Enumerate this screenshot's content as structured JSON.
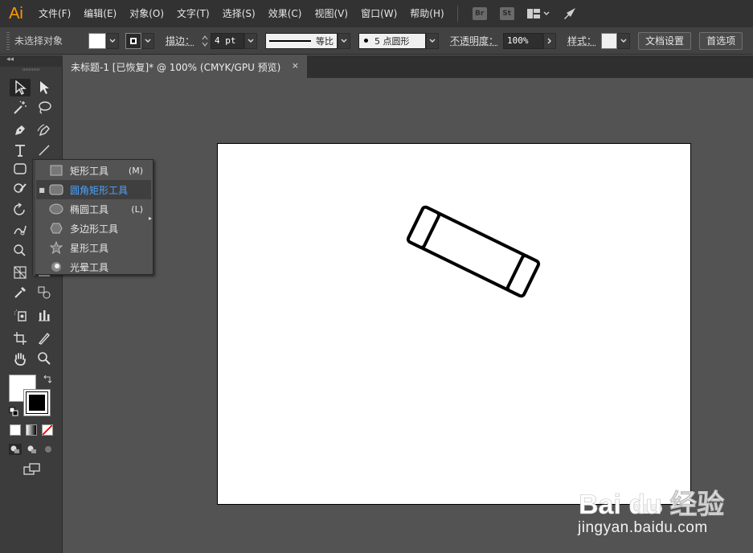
{
  "app": {
    "logo_text": "Ai"
  },
  "menu": {
    "items": [
      "文件(F)",
      "编辑(E)",
      "对象(O)",
      "文字(T)",
      "选择(S)",
      "效果(C)",
      "视图(V)",
      "窗口(W)",
      "帮助(H)"
    ],
    "bridge_label": "Br",
    "stock_label": "St"
  },
  "control": {
    "selection_text": "未选择对象",
    "stroke_label": "描边：",
    "stroke_weight": "4 pt",
    "profile_label": "等比",
    "brush_label": "5 点圆形",
    "opacity_label": "不透明度：",
    "opacity_value": "100%",
    "style_label": "样式：",
    "doc_settings": "文档设置",
    "preferences": "首选项"
  },
  "tab": {
    "title": "未标题-1 [已恢复]* @ 100% (CMYK/GPU 预览)",
    "close": "×"
  },
  "flyout": {
    "items": [
      {
        "label": "矩形工具",
        "shortcut": "(M)",
        "icon": "rectangle-icon",
        "selected": false
      },
      {
        "label": "圆角矩形工具",
        "shortcut": "",
        "icon": "rounded-rectangle-icon",
        "selected": true
      },
      {
        "label": "椭圆工具",
        "shortcut": "(L)",
        "icon": "ellipse-icon",
        "selected": false
      },
      {
        "label": "多边形工具",
        "shortcut": "",
        "icon": "polygon-icon",
        "selected": false
      },
      {
        "label": "星形工具",
        "shortcut": "",
        "icon": "star-icon",
        "selected": false
      },
      {
        "label": "光晕工具",
        "shortcut": "",
        "icon": "flare-icon",
        "selected": false
      }
    ],
    "selected_mark": "■"
  },
  "watermark": {
    "logo_text": "Bai du 经验",
    "url_text": "jingyan.baidu.com"
  },
  "colors": {
    "menubar": "#323232",
    "controlbar": "#424242",
    "canvas": "#535353",
    "accent": "#4da3ff",
    "logo": "#ff9a00"
  }
}
